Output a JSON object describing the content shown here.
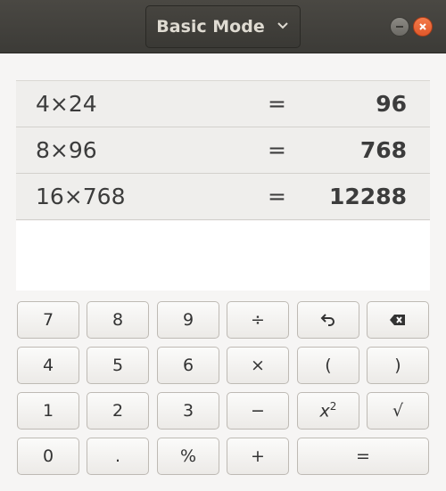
{
  "header": {
    "mode_label": "Basic Mode",
    "icons": {
      "dropdown": "chevron-down-icon",
      "minimize": "minimize-icon",
      "close": "close-icon"
    },
    "close_color": "#e9592b"
  },
  "history": [
    {
      "expression": "4×24",
      "equals": "=",
      "result": "96"
    },
    {
      "expression": "8×96",
      "equals": "=",
      "result": "768"
    },
    {
      "expression": "16×768",
      "equals": "=",
      "result": "12288"
    }
  ],
  "entry": {
    "value": ""
  },
  "keypad": {
    "row1": [
      "7",
      "8",
      "9",
      "÷"
    ],
    "row2": [
      "4",
      "5",
      "6",
      "×",
      "(",
      ")"
    ],
    "row3": [
      "1",
      "2",
      "3",
      "−"
    ],
    "square_base": "x",
    "square_exp": "2",
    "sqrt": "√",
    "row4": [
      "0",
      ".",
      "%",
      "+",
      "="
    ],
    "icons": {
      "undo": "undo-icon",
      "backspace": "backspace-icon"
    }
  }
}
